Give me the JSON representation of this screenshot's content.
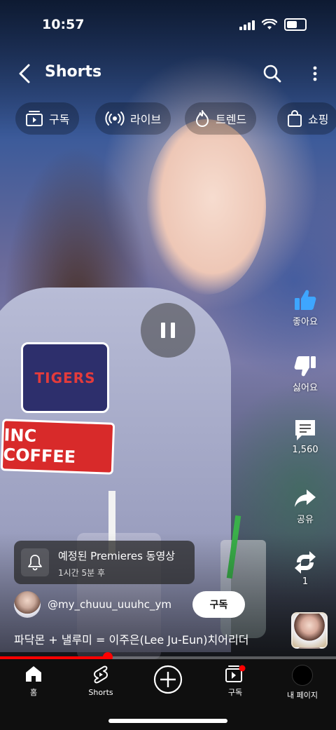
{
  "status_bar": {
    "time": "10:57"
  },
  "header": {
    "title": "Shorts"
  },
  "chips": [
    {
      "label": "구독",
      "icon": "subscriptions-icon"
    },
    {
      "label": "라이브",
      "icon": "live-icon"
    },
    {
      "label": "트렌드",
      "icon": "trending-icon"
    },
    {
      "label": "쇼핑",
      "icon": "shopping-bag-icon"
    }
  ],
  "video_text": {
    "patch_1": "TIGERS",
    "patch_2": "INC COFFEE"
  },
  "actions": {
    "like": "좋아요",
    "dislike": "싫어요",
    "comments": "1,560",
    "share": "공유",
    "remix": "1"
  },
  "premiere": {
    "title": "예정된 Premieres 동영상",
    "subtitle": "1시간 5분 후"
  },
  "channel": {
    "name": "@my_chuuu_uuuhc_ym",
    "subscribe_label": "구독"
  },
  "video": {
    "title": "파닥몬 + 낼루미 = 이주은(Lee Ju-Eun)치어리더",
    "progress": 0.32
  },
  "nav": {
    "home": "홈",
    "shorts": "Shorts",
    "subscriptions": "구독",
    "profile": "내 페이지"
  },
  "colors": {
    "accent": "#ff0000",
    "nav_bg": "#0f0f0f",
    "like_active": "#3ea6ff"
  }
}
